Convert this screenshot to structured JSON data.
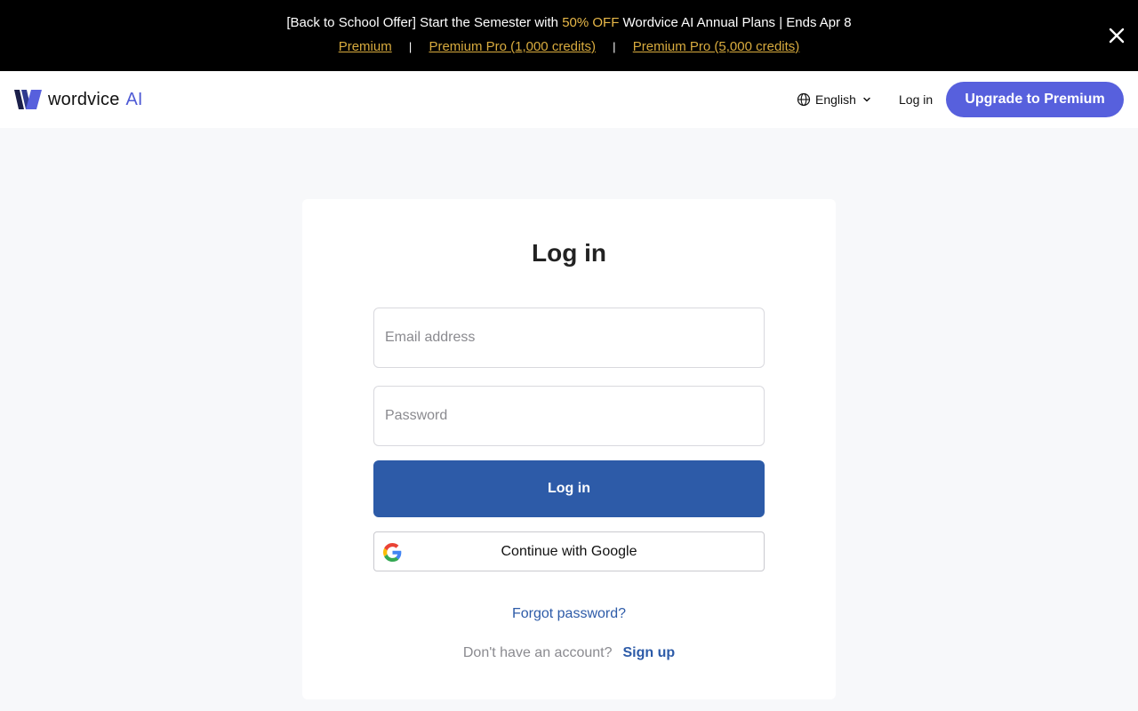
{
  "promo": {
    "prefix": "[Back to School Offer] Start the Semester with ",
    "highlight": "50% OFF",
    "suffix": " Wordvice AI Annual Plans | Ends Apr 8",
    "links": [
      "Premium",
      "Premium Pro (1,000 credits)",
      "Premium Pro (5,000 credits)"
    ],
    "separator": "|",
    "close_icon": "close-icon",
    "highlight_color": "#e9b949"
  },
  "header": {
    "brand": "wordvice",
    "brand_suffix": "AI",
    "language": "English",
    "login_label": "Log in",
    "upgrade_label": "Upgrade to Premium",
    "accent_color": "#5760dd"
  },
  "login_form": {
    "title": "Log in",
    "email_placeholder": "Email address",
    "email_value": "",
    "password_placeholder": "Password",
    "password_value": "",
    "submit_label": "Log in",
    "google_label": "Continue with Google",
    "forgot_label": "Forgot password?",
    "no_account_text": "Don't have an account?",
    "signup_label": "Sign up",
    "primary_color": "#2d5ba8"
  }
}
